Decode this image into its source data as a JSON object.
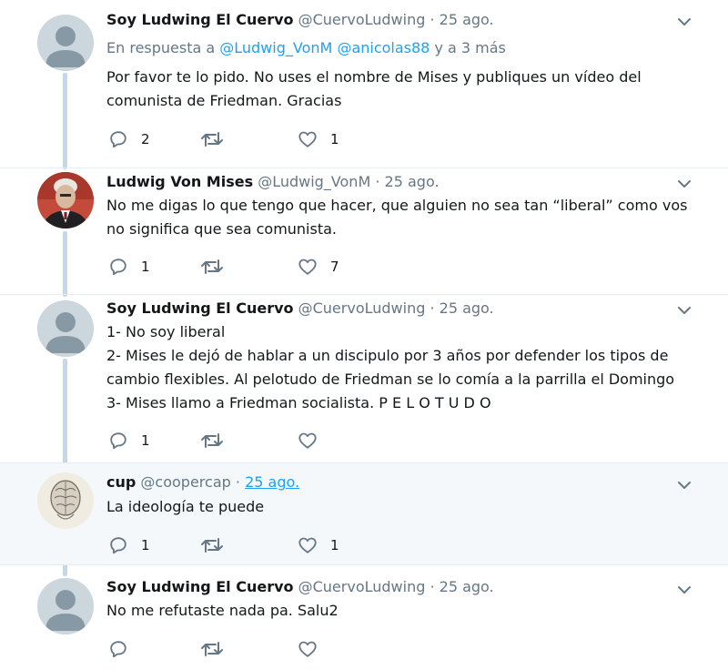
{
  "tweets": [
    {
      "name": "Soy Ludwing El Cuervo",
      "handle": "@CuervoLudwing",
      "sep": "·",
      "time": "25 ago.",
      "reply_prefix": "En respuesta a",
      "reply_user1": "@Ludwig_VonM",
      "reply_user2": "@anicolas88",
      "reply_suffix": "y a 3 más",
      "lines": [
        "Por favor te lo pido. No uses el nombre de Mises y publiques un vídeo del",
        "comunista de Friedman. Gracias"
      ],
      "replies": "2",
      "retweets": "",
      "likes": "1",
      "avatar": "default-avatar"
    },
    {
      "name": "Ludwig Von Mises",
      "handle": "@Ludwig_VonM",
      "sep": "·",
      "time": "25 ago.",
      "lines": [
        "No me digas lo que tengo que hacer, que alguien no sea tan “liberal” como vos",
        "no significa que sea comunista."
      ],
      "replies": "1",
      "retweets": "",
      "likes": "7",
      "avatar": "portrait-photo"
    },
    {
      "name": "Soy Ludwing El Cuervo",
      "handle": "@CuervoLudwing",
      "sep": "·",
      "time": "25 ago.",
      "lines": [
        "1- No soy liberal",
        "2- Mises le dejó de hablar a un discipulo por 3 años por defender los tipos de",
        "cambio flexibles. Al pelotudo de Friedman se lo comía a la parrilla el Domingo",
        "3- Mises llamo a Friedman socialista. P E L O T U D O"
      ],
      "replies": "1",
      "retweets": "",
      "likes": "",
      "avatar": "default-avatar"
    },
    {
      "name": "cup",
      "handle": "@coopercap",
      "sep": "·",
      "time": "25 ago.",
      "lines": [
        "La ideología te puede"
      ],
      "replies": "1",
      "retweets": "",
      "likes": "1",
      "avatar": "brain-drawing"
    },
    {
      "name": "Soy Ludwing El Cuervo",
      "handle": "@CuervoLudwing",
      "sep": "·",
      "time": "25 ago.",
      "lines": [
        "No me refutaste nada pa. Salu2"
      ],
      "replies": "",
      "retweets": "",
      "likes": "",
      "avatar": "default-avatar"
    }
  ],
  "icons": {
    "reply": "reply-icon",
    "retweet": "retweet-icon",
    "like": "heart-icon",
    "menu": "chevron-down-icon"
  },
  "colors": {
    "link": "#1da1f2",
    "muted": "#657786",
    "thread_line": "#c4d8ea",
    "highlight_bg": "#f5f8fa"
  }
}
